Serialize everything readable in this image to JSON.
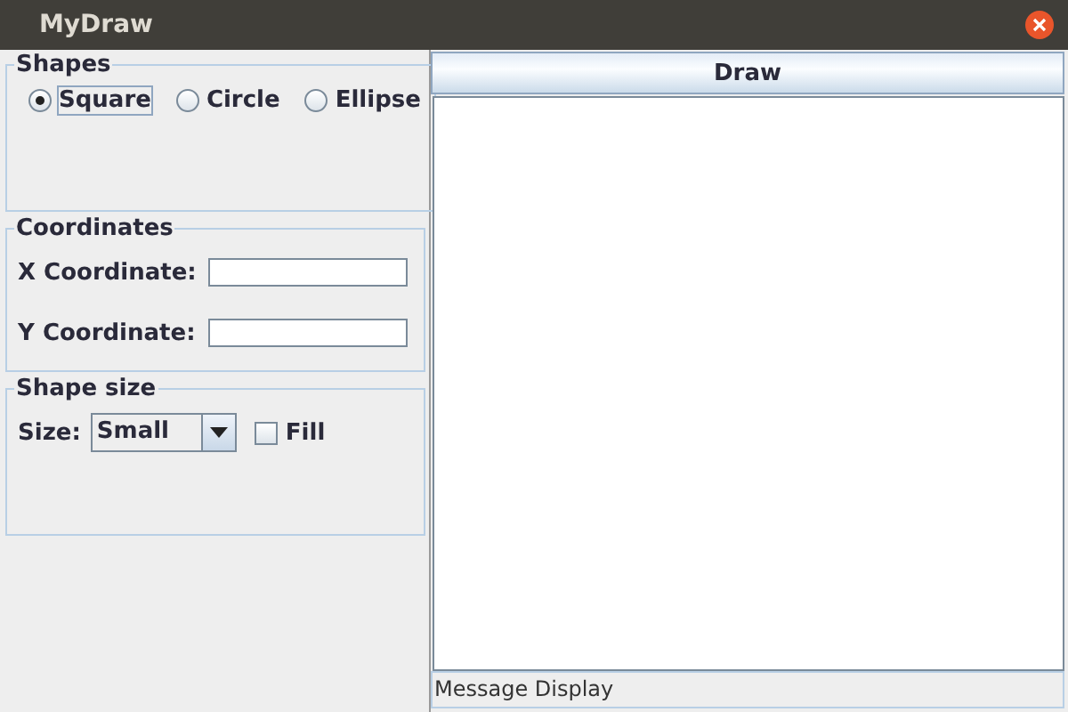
{
  "window": {
    "title": "MyDraw"
  },
  "shapes": {
    "title": "Shapes",
    "options": [
      {
        "label": "Square",
        "selected": true
      },
      {
        "label": "Circle",
        "selected": false
      },
      {
        "label": "Ellipse",
        "selected": false
      }
    ]
  },
  "coordinates": {
    "title": "Coordinates",
    "fields": [
      {
        "label": "X Coordinate:"
      },
      {
        "label": "Y Coordinate:"
      }
    ]
  },
  "shape_size": {
    "title": "Shape size",
    "size_label": "Size:",
    "size_value": "Small",
    "fill": {
      "label": "Fill",
      "checked": false
    }
  },
  "draw_button": "Draw",
  "status_bar": "Message Display"
}
